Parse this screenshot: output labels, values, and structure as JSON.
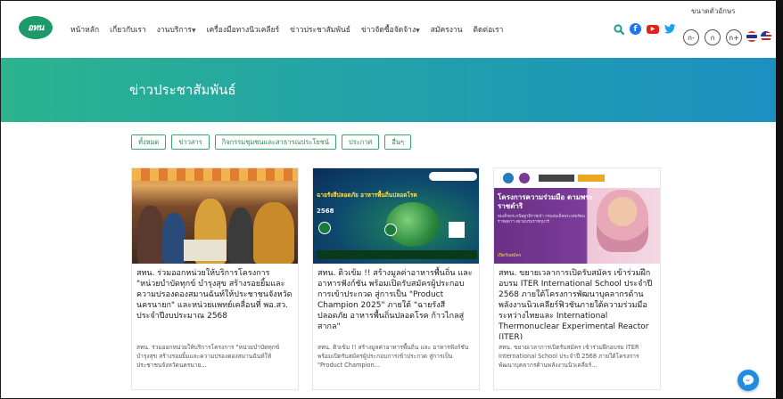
{
  "nav": {
    "logo_text": "อทน",
    "items": [
      {
        "label": "หน้าหลัก",
        "dropdown": false
      },
      {
        "label": "เกี่ยวกับเรา",
        "dropdown": false
      },
      {
        "label": "งานบริการ",
        "dropdown": true
      },
      {
        "label": "เครื่องมือทางนิวเคลียร์",
        "dropdown": false
      },
      {
        "label": "ข่าวประชาสัมพันธ์",
        "dropdown": false
      },
      {
        "label": "ข่าวจัดซื้อจัดจ้าง",
        "dropdown": true
      },
      {
        "label": "สมัครงาน",
        "dropdown": false
      },
      {
        "label": "ติดต่อเรา",
        "dropdown": false
      }
    ],
    "icons": [
      "search-icon",
      "facebook-icon",
      "youtube-icon",
      "twitter-icon"
    ],
    "font_size_label": "ขนาดตัวอักษร",
    "font_size_buttons": [
      "ก-",
      "ก",
      "ก+"
    ],
    "languages": [
      "thai-flag-icon",
      "english-flag-icon"
    ]
  },
  "banner": {
    "title": "ข่าวประชาสัมพันธ์",
    "gradient_colors": [
      "#2bb48e",
      "#1c8fc0"
    ]
  },
  "filters": [
    "ทั้งหมด",
    "ข่าวสาร",
    "กิจกรรมชุมชนและสาธารณประโยชน์",
    "ประกาศ",
    "อื่นๆ"
  ],
  "cards": [
    {
      "title": "สทน. ร่วมออกหน่วยให้บริการโครงการ \"หน่วยบำบัดทุกข์ บำรุงสุข สร้างรอยยิ้มและความปรองดองสมานฉันท์ให้ประชาชนจังหวัดนครนายก\" และหน่วยแพทย์เคลื่อนที่ พอ.สว. ประจำปีงบประมาณ 2568",
      "desc": "สทน. ร่วมออกหน่วยให้บริการโครงการ \"หน่วยบำบัดทุกข์ บำรุงสุข สร้างรอยยิ้มและความปรองดองสมานฉันท์ให้ประชาชนจังหวัดนครนาย..."
    },
    {
      "title": "สทน. ติวเข้ม !! สร้างมูลค่าอาหารพื้นถิ่น และ อาหารฟังก์ชัน พร้อมเปิดรับสมัครผู้ประกอบการเข้าประกวด สู่การเป็น \"Product Champion 2025\" ภายใต้ \"ฉายรังสีปลอดภัย อาหารพื้นถิ่นปลอดโรค ก้าวไกลสู่สากล\"",
      "desc": "สทน. ติวเข้ม !! สร้างมูลค่าอาหารพื้นถิ่น และ อาหารฟังก์ชัน พร้อมเปิดรับสมัครผู้ประกอบการเข้าประกวด สู่การเป็น \"Product Champion...",
      "thumb_text": {
        "headline": "ฉายรังสีปลอดภัย อาหารพื้นถิ่นปลอดโรค",
        "year": "2568"
      }
    },
    {
      "title": "สทน. ขยายเวลาการเปิดรับสมัคร เข้าร่วมฝึกอบรม ITER International School ประจำปี 2568 ภายใต้โครงการพัฒนาบุคลากรด้านพลังงานนิวเคลียร์ฟิวชันภายใต้ความร่วมมือระหว่างไทยและ International Thermonuclear Experimental Reactor (ITER)",
      "desc": "สทน. ขยายเวลาการเปิดรับสมัคร เข้าร่วมฝึกอบรม ITER International School ประจำปี 2568 ภายใต้โครงการพัฒนาบุคลากรด้านพลังงานนิวเคลียร์...",
      "thumb_text": {
        "headline": "โครงการความร่วมมือ ตามพระราชดำริ",
        "sub": "สมเด็จพระกนิษฐาธิราชเจ้า กรมสมเด็จพระเทพรัตนราชสุดาฯ สยามบรมราชกุมารี",
        "apply": "เปิดรับสมัคร"
      }
    }
  ],
  "chat_icon": "chat-bubble-icon"
}
